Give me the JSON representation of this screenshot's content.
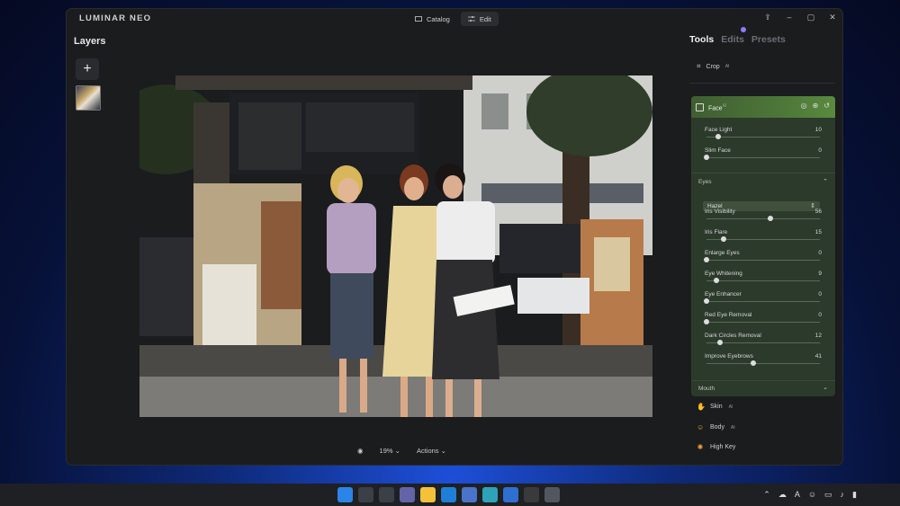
{
  "app": {
    "logo": "LUMINAR NEO"
  },
  "topnav": {
    "catalog": "Catalog",
    "edit": "Edit"
  },
  "layers": {
    "title": "Layers"
  },
  "bottom": {
    "zoom": "19%",
    "actions": "Actions"
  },
  "panel": {
    "tabs": [
      "Tools",
      "Edits",
      "Presets"
    ],
    "active_tab": "Tools",
    "crop": "Crop",
    "face": {
      "label": "Face",
      "sliders": [
        {
          "name": "Face Light",
          "value": "10",
          "pos": 10
        },
        {
          "name": "Slim Face",
          "value": "0",
          "pos": 0
        }
      ],
      "eyes": {
        "label": "Eyes",
        "color": "Hazel",
        "sliders": [
          {
            "name": "Iris Visibility",
            "value": "56",
            "pos": 56
          },
          {
            "name": "Iris Flare",
            "value": "15",
            "pos": 15
          },
          {
            "name": "Enlarge Eyes",
            "value": "0",
            "pos": 0
          },
          {
            "name": "Eye Whitening",
            "value": "9",
            "pos": 9
          },
          {
            "name": "Eye Enhancer",
            "value": "0",
            "pos": 0
          },
          {
            "name": "Red Eye Removal",
            "value": "0",
            "pos": 0
          },
          {
            "name": "Dark Circles Removal",
            "value": "12",
            "pos": 12
          },
          {
            "name": "Improve Eyebrows",
            "value": "41",
            "pos": 41
          }
        ]
      },
      "mouth": "Mouth"
    },
    "tools": [
      "Skin",
      "Body",
      "High Key"
    ]
  },
  "colors": {
    "accent_green": "#4f7a39",
    "window_bg": "#1b1c1e",
    "badge": "#8d7bff"
  }
}
